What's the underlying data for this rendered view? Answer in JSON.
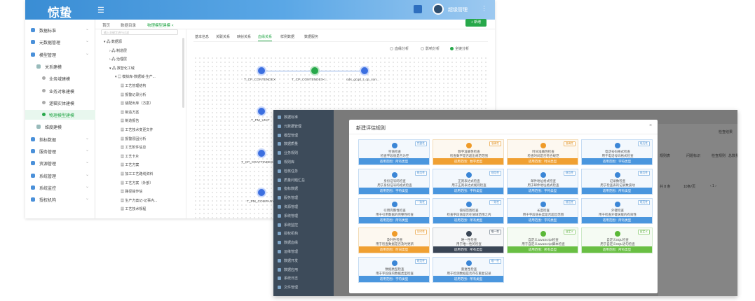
{
  "back_window": {
    "logo": "惊蛰",
    "user_name": "超级管理",
    "top_tabs": [
      "首页",
      "数据目录",
      "物理模型建模 ×"
    ],
    "new_button": "+ 新增",
    "sidebar": [
      {
        "label": "数据标准",
        "level": 0
      },
      {
        "label": "元数据管理",
        "level": 0
      },
      {
        "label": "模型管理",
        "level": 0
      },
      {
        "label": "关系建模",
        "level": 1
      },
      {
        "label": "业务域建模",
        "level": 2
      },
      {
        "label": "业务对象建模",
        "level": 2
      },
      {
        "label": "逻辑实体建模",
        "level": 2
      },
      {
        "label": "物理模型建模",
        "level": 2,
        "active": true
      },
      {
        "label": "维度建模",
        "level": 1
      },
      {
        "label": "指标数据",
        "level": 0
      },
      {
        "label": "服务管理",
        "level": 0
      },
      {
        "label": "资源管理",
        "level": 0
      },
      {
        "label": "系统管理",
        "level": 0
      },
      {
        "label": "系统监控",
        "level": 0
      },
      {
        "label": "授权机构",
        "level": 0
      }
    ],
    "tree": {
      "search_placeholder": "输入关键字进行过滤",
      "nodes": [
        {
          "label": "▾ 🖧 数据源",
          "indent": 0
        },
        {
          "label": "› 🖧 制造层",
          "indent": 1
        },
        {
          "label": "› 🖧 治理层",
          "indent": 1
        },
        {
          "label": "▾ 🖧 数智化工域",
          "indent": 1
        },
        {
          "label": "▾ ▤ 模拟库-数据域-生产...",
          "indent": 2
        },
        {
          "label": "▦ 工艺管理结构",
          "indent": 3
        },
        {
          "label": "▦ 报警记录分析",
          "indent": 3
        },
        {
          "label": "▦ 装配出库（方案）",
          "indent": 3
        },
        {
          "label": "▦ 制造方案",
          "indent": 3
        },
        {
          "label": "▦ 制造报告",
          "indent": 3
        },
        {
          "label": "▦ 工艺技术变更文件",
          "indent": 3
        },
        {
          "label": "▦ 报警原因分析",
          "indent": 3
        },
        {
          "label": "▦ 工艺附件信息",
          "indent": 3
        },
        {
          "label": "▦ 工艺卡片",
          "indent": 3
        },
        {
          "label": "▦ 工艺方案",
          "indent": 3
        },
        {
          "label": "▦ 加工工艺路线资料",
          "indent": 3
        },
        {
          "label": "▦ 工艺方案（外部）",
          "indent": 3
        },
        {
          "label": "▦ 路径操作信",
          "indent": 3
        },
        {
          "label": "▦ 生产方案记-记事内...",
          "indent": 3
        },
        {
          "label": "▦ 工艺技术规程",
          "indent": 3
        }
      ]
    },
    "detail_tabs": [
      "基本信息",
      "关联关系",
      "映射关系",
      "血缘关系",
      "样例数据",
      "数据服务"
    ],
    "radio_options": [
      "血缘分析",
      "影响分析",
      "全链分析"
    ],
    "graph": {
      "row1": [
        "T_CP_CONTENDEX",
        "T_CP_CONTENDEX<...",
        "ods_gcqd_t_cp_con..."
      ],
      "row2": [
        "T_PM_UNIT"
      ],
      "row3": [
        "T_CP_CRAFTINDEXAP..."
      ],
      "row4": [
        "T_PM_COMPANY"
      ]
    }
  },
  "front_window": {
    "sidebar": [
      "数据标准",
      "元数据管理",
      "模型管理",
      "数据质量",
      "业务规则",
      "规则库",
      "检核任务",
      "质量问题汇总",
      "指标数据",
      "服务管理",
      "资源管理",
      "系统管理",
      "系统监控",
      "授权机构",
      "数据血缘",
      "运维管理",
      "数据开发",
      "数据应用",
      "系统日志",
      "文件管理"
    ],
    "right_labels": [
      "检查结果",
      "规则表",
      "问题标识",
      "检查规则",
      "总数量",
      "共 8 条",
      "10条/页",
      "‹ 1 ›"
    ],
    "dialog": {
      "title": "新建评估规则",
      "close": "×",
      "cards": [
        {
          "title": "空值检查",
          "desc": "检查字段值是否为空",
          "bar": "适用范围：所有类型",
          "tag": "完整性",
          "color": "blue",
          "icon": "info-icon"
        },
        {
          "title": "数字准确性检查",
          "desc": "检查数字是否超出规范范围",
          "bar": "适用范围：数字类型",
          "tag": "准确性",
          "color": "orange",
          "icon": "location-icon"
        },
        {
          "title": "时间准确性检查",
          "desc": "检查时间是否符合规范",
          "bar": "适用范围：时间类型",
          "tag": "准确性",
          "color": "orange",
          "icon": "send-icon"
        },
        {
          "title": "电话号码格式检查",
          "desc": "用于电话号码格式检查",
          "bar": "适用范围：字符类型",
          "tag": "规范性",
          "color": "blue",
          "icon": "phone-icon"
        },
        {
          "title": "身份证号码检查",
          "desc": "用于身份证号码格式检查",
          "bar": "适用范围：字符类型",
          "tag": "规范性",
          "color": "blue",
          "icon": "id-card-icon"
        },
        {
          "title": "正则表达式检查",
          "desc": "用于正则表达式规则检查",
          "bar": "适用范围：字符类型",
          "tag": "规范性",
          "color": "blue",
          "icon": "check-circle-icon"
        },
        {
          "title": "邮件地址格式检查",
          "desc": "用于邮件地址格式检查",
          "bar": "适用范围：字符类型",
          "tag": "规范性",
          "color": "blue",
          "icon": "document-icon"
        },
        {
          "title": "记录数检查",
          "desc": "用于检查表的记录数波动",
          "bar": "适用范围：所有类型",
          "tag": "规范性",
          "color": "blue",
          "icon": "calendar-icon"
        },
        {
          "title": "引用完整性检查",
          "desc": "用于引用数据的完整性检查",
          "bar": "适用范围：所有类型",
          "tag": "一致性",
          "color": "blue",
          "icon": "target-icon"
        },
        {
          "title": "值域范围检查",
          "desc": "检查字段值是否在值域范围之内",
          "bar": "适用范围：所有类型",
          "tag": "一致性",
          "color": "blue",
          "icon": "cycle-icon"
        },
        {
          "title": "长度检查",
          "desc": "用于字段值长度是否超出范围",
          "bar": "适用范围：字符类型",
          "tag": "规范性",
          "color": "blue",
          "icon": "ruler-icon"
        },
        {
          "title": "外键检查",
          "desc": "用于检查外键关联的有效性",
          "bar": "适用范围：所有类型",
          "tag": "规范性",
          "color": "blue",
          "icon": "key-icon"
        },
        {
          "title": "及时性检查",
          "desc": "用于检查数据是否及时更新",
          "bar": "适用范围：时间类型",
          "tag": "及时性",
          "color": "orange",
          "icon": "clock-icon"
        },
        {
          "title": "唯一性检查",
          "desc": "用于唯一性的检查",
          "bar": "适用范围：所有类型",
          "tag": "唯一性",
          "color": "dark",
          "icon": "bulb-icon"
        },
        {
          "title": "自定义JavaScript检查",
          "desc": "用于自定义JavaScript脚本检查",
          "bar": "适用范围：所有类型",
          "tag": "自定义",
          "color": "green",
          "icon": "script-icon"
        },
        {
          "title": "自定义SQL检查",
          "desc": "用于自定义SQL语句检查",
          "bar": "适用范围：所有类型",
          "tag": "自定义",
          "color": "green",
          "icon": "chat-icon"
        },
        {
          "title": "数据类型检查",
          "desc": "用于字段值的数据类型检查",
          "bar": "适用范围：字符类型",
          "tag": "规范性",
          "color": "blue",
          "icon": "diamond-icon"
        },
        {
          "title": "重复性检查",
          "desc": "用于检测数据是否存在重复记录",
          "bar": "适用范围：所有类型",
          "tag": "唯一性",
          "color": "blue",
          "icon": "flag-icon"
        }
      ]
    }
  }
}
